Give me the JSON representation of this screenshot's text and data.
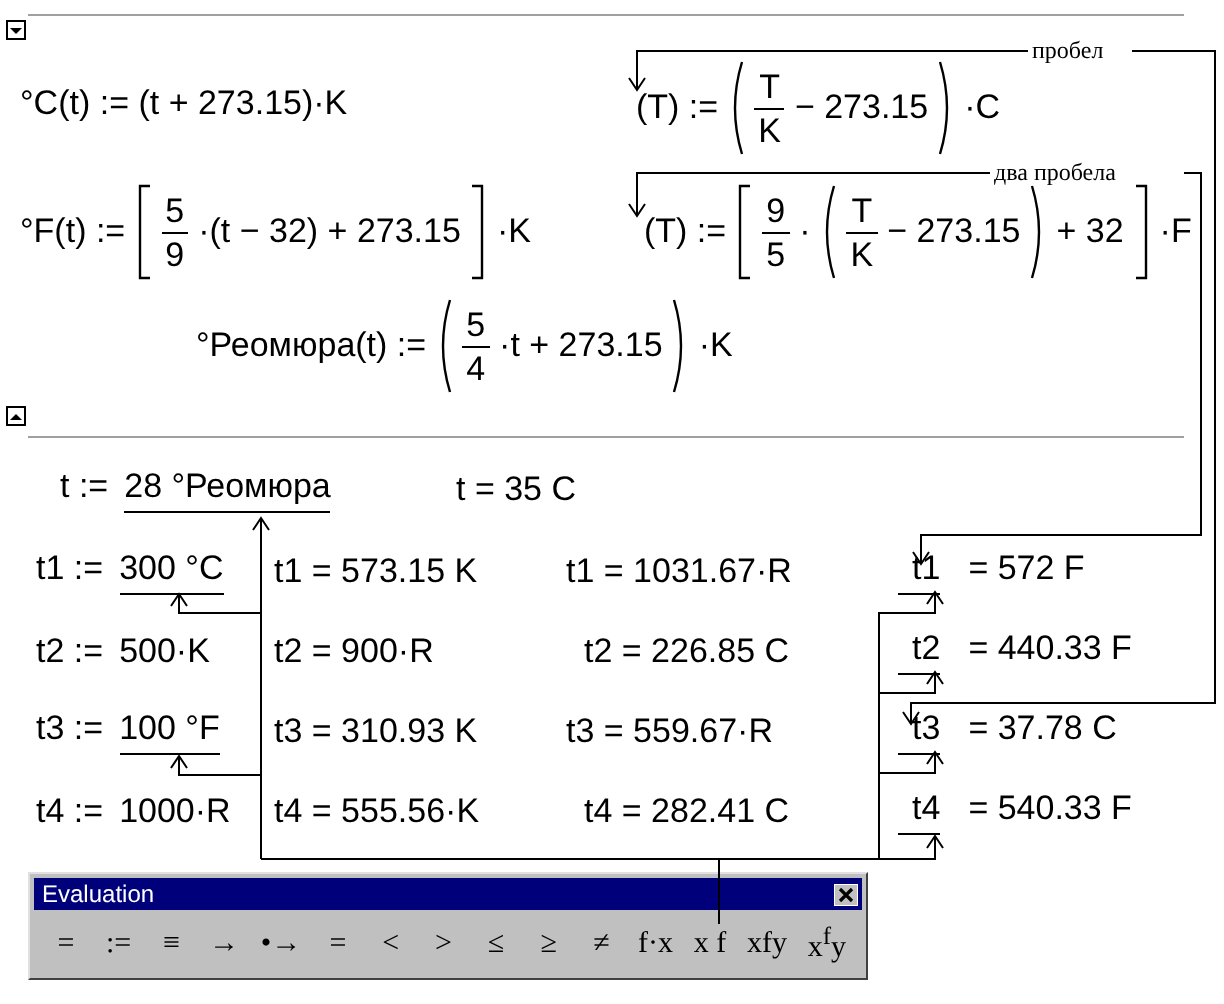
{
  "region_markers": [
    {
      "kind": "collapse"
    },
    {
      "kind": "expand"
    }
  ],
  "definitions": [
    {
      "parts": [
        {
          "kind": "text",
          "text": "°C(t) := (t + 273.15)·K"
        }
      ]
    },
    {
      "parts": [
        {
          "kind": "text",
          "text": "(T) :="
        },
        {
          "kind": "open_paren"
        },
        {
          "kind": "frac",
          "num": "T",
          "den": "K"
        },
        {
          "kind": "text",
          "text": "− 273.15"
        },
        {
          "kind": "close_paren"
        },
        {
          "kind": "text",
          "text": "·C"
        }
      ]
    },
    {
      "parts": [
        {
          "kind": "text",
          "text": "°F(t) :="
        },
        {
          "kind": "open_bracket"
        },
        {
          "kind": "frac",
          "num": "5",
          "den": "9"
        },
        {
          "kind": "text",
          "text": "·(t − 32) + 273.15"
        },
        {
          "kind": "close_bracket"
        },
        {
          "kind": "text",
          "text": "·K"
        }
      ]
    },
    {
      "parts": [
        {
          "kind": "text",
          "text": "(T) :="
        },
        {
          "kind": "open_bracket"
        },
        {
          "kind": "frac",
          "num": "9",
          "den": "5"
        },
        {
          "kind": "text",
          "text": "·"
        },
        {
          "kind": "open_paren"
        },
        {
          "kind": "frac",
          "num": "T",
          "den": "K"
        },
        {
          "kind": "text",
          "text": "− 273.15"
        },
        {
          "kind": "close_paren"
        },
        {
          "kind": "text",
          "text": "+ 32"
        },
        {
          "kind": "close_bracket"
        },
        {
          "kind": "text",
          "text": "·F"
        }
      ]
    },
    {
      "parts": [
        {
          "kind": "text",
          "text": "°Реомюра(t) :="
        },
        {
          "kind": "open_paren"
        },
        {
          "kind": "frac",
          "num": "5",
          "den": "4"
        },
        {
          "kind": "text",
          "text": "·t + 273.15"
        },
        {
          "kind": "close_paren"
        },
        {
          "kind": "text",
          "text": "·K"
        }
      ]
    }
  ],
  "annotations": [
    "пробел",
    "два пробела"
  ],
  "header": [
    [
      {
        "text": "t :=",
        "underlined": false
      },
      {
        "text": "28 °Реомюра",
        "underlined": true
      }
    ],
    [
      {
        "text": "t = 35 C",
        "underlined": false
      }
    ]
  ],
  "rows": [
    [
      [
        {
          "text": "t1 :=",
          "underlined": false
        },
        {
          "text": "300 °C",
          "underlined": true
        }
      ],
      [
        {
          "text": "t1 = 573.15 K",
          "underlined": false
        }
      ],
      [
        {
          "text": "t1 = 1031.67·R",
          "underlined": false
        }
      ],
      [
        {
          "text": "t1",
          "underlined": true
        },
        {
          "text": "= 572 F",
          "underlined": false
        }
      ]
    ],
    [
      [
        {
          "text": "t2 :=",
          "underlined": false
        },
        {
          "text": "500·K",
          "underlined": false
        }
      ],
      [
        {
          "text": "t2 = 900·R",
          "underlined": false
        }
      ],
      [
        {
          "text": "t2 = 226.85 C",
          "underlined": false
        }
      ],
      [
        {
          "text": "t2",
          "underlined": true
        },
        {
          "text": "= 440.33 F",
          "underlined": false
        }
      ]
    ],
    [
      [
        {
          "text": "t3 :=",
          "underlined": false
        },
        {
          "text": "100 °F",
          "underlined": true
        }
      ],
      [
        {
          "text": "t3 = 310.93 K",
          "underlined": false
        }
      ],
      [
        {
          "text": "t3 = 559.67·R",
          "underlined": false
        }
      ],
      [
        {
          "text": "t3",
          "underlined": true
        },
        {
          "text": "= 37.78 C",
          "underlined": false
        }
      ]
    ],
    [
      [
        {
          "text": "t4 :=",
          "underlined": false
        },
        {
          "text": "1000·R",
          "underlined": false
        }
      ],
      [
        {
          "text": "t4 = 555.56·K",
          "underlined": false
        }
      ],
      [
        {
          "text": "t4 = 282.41 C",
          "underlined": false
        }
      ],
      [
        {
          "text": "t4",
          "underlined": true
        },
        {
          "text": "= 540.33 F",
          "underlined": false
        }
      ]
    ]
  ],
  "toolbar": {
    "title": "Evaluation",
    "buttons": [
      "=",
      ":=",
      "≡",
      "→",
      "•→",
      "=",
      "<",
      ">",
      "≤",
      "≥",
      "≠",
      "f·x",
      "x f",
      "xfy",
      "x$^{f}$y"
    ]
  }
}
